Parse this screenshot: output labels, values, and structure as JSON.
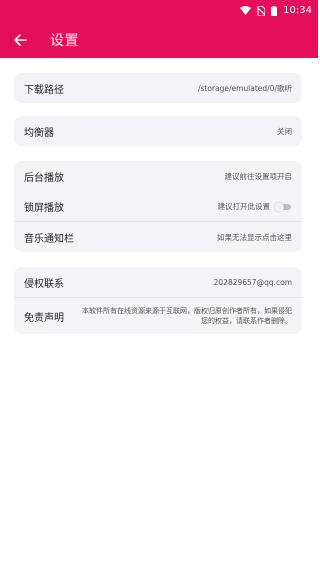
{
  "status_bar": {
    "time": "10:34",
    "icons": [
      "wifi-icon",
      "no-sim-icon",
      "battery-icon"
    ]
  },
  "app_bar": {
    "back_icon": "arrow-left-icon",
    "title": "设置"
  },
  "sections": {
    "download": {
      "label": "下载路径",
      "value": "/storage/emulated/0/歌听"
    },
    "equalizer": {
      "label": "均衡器",
      "value": "关闭"
    },
    "background_play": {
      "label": "后台播放",
      "value": "建议前往设置项开启"
    },
    "lockscreen_play": {
      "label": "锁屏播放",
      "value": "建议打开此设置",
      "toggle_on": false
    },
    "music_notification": {
      "label": "音乐通知栏",
      "value": "如果无法显示点击这里"
    },
    "contact": {
      "label": "侵权联系",
      "value": "202829657@qq.com"
    },
    "disclaimer": {
      "label": "免责声明",
      "value": "本软件所有在线资源来源于互联网，版权归原创作者所有，如果侵犯您的权益，请联系作者删除。"
    }
  },
  "colors": {
    "accent": "#e50e5a",
    "card_background": "#f4f4f8"
  }
}
